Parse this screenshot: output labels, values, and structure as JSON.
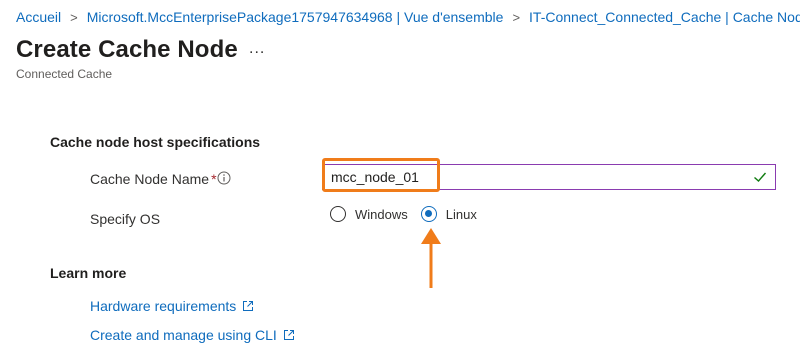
{
  "breadcrumb": {
    "items": [
      "Accueil",
      "Microsoft.MccEnterprisePackage1757947634968 | Vue d'ensemble",
      "IT-Connect_Connected_Cache | Cache Nodes"
    ],
    "separator": ">"
  },
  "header": {
    "title": "Create Cache Node",
    "more": "...",
    "subtitle": "Connected Cache"
  },
  "form": {
    "section_title": "Cache node host specifications",
    "cache_node_name": {
      "label": "Cache Node Name",
      "required_mark": "*",
      "value": "mcc_node_01"
    },
    "os": {
      "label": "Specify OS",
      "options": [
        "Windows",
        "Linux"
      ],
      "selected": "Linux"
    }
  },
  "learn_more": {
    "title": "Learn more",
    "links": [
      "Hardware requirements",
      "Create and manage using CLI"
    ]
  },
  "colors": {
    "link": "#0f6cbd",
    "highlight": "#f07c1a",
    "input_border": "#8a3bb0",
    "valid_check": "#107c10",
    "radio_selected": "#0f6cbd"
  }
}
